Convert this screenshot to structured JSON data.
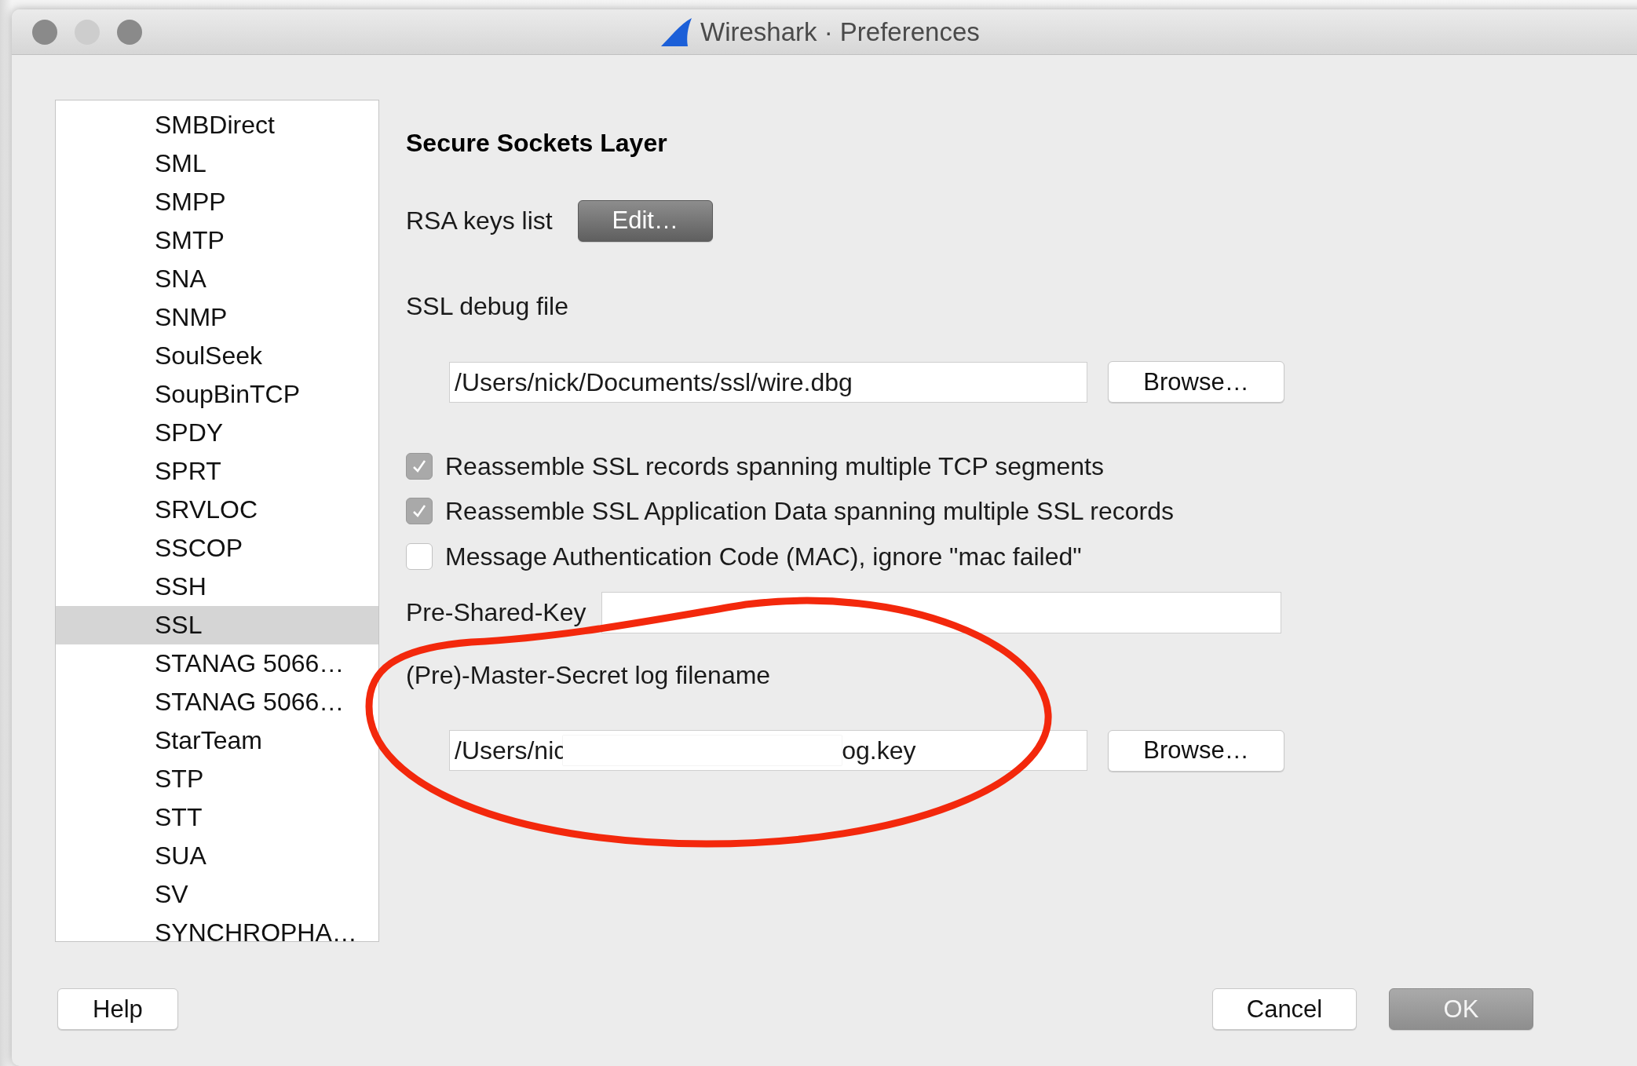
{
  "window": {
    "title": "Wireshark · Preferences"
  },
  "sidebar": {
    "items": [
      {
        "label": "SMBDirect",
        "selected": false
      },
      {
        "label": "SML",
        "selected": false
      },
      {
        "label": "SMPP",
        "selected": false
      },
      {
        "label": "SMTP",
        "selected": false
      },
      {
        "label": "SNA",
        "selected": false
      },
      {
        "label": "SNMP",
        "selected": false
      },
      {
        "label": "SoulSeek",
        "selected": false
      },
      {
        "label": "SoupBinTCP",
        "selected": false
      },
      {
        "label": "SPDY",
        "selected": false
      },
      {
        "label": "SPRT",
        "selected": false
      },
      {
        "label": "SRVLOC",
        "selected": false
      },
      {
        "label": "SSCOP",
        "selected": false
      },
      {
        "label": "SSH",
        "selected": false
      },
      {
        "label": "SSL",
        "selected": true
      },
      {
        "label": "STANAG 5066…",
        "selected": false
      },
      {
        "label": "STANAG 5066…",
        "selected": false
      },
      {
        "label": "StarTeam",
        "selected": false
      },
      {
        "label": "STP",
        "selected": false
      },
      {
        "label": "STT",
        "selected": false
      },
      {
        "label": "SUA",
        "selected": false
      },
      {
        "label": "SV",
        "selected": false
      },
      {
        "label": "SYNCHROPHA…",
        "selected": false
      }
    ]
  },
  "panel": {
    "heading": "Secure Sockets Layer",
    "rsa_keys": {
      "label": "RSA keys list",
      "button": "Edit…"
    },
    "debug_file": {
      "label": "SSL debug file",
      "value": "/Users/nick/Documents/ssl/wire.dbg",
      "button": "Browse…"
    },
    "checkboxes": [
      {
        "label": "Reassemble SSL records spanning multiple TCP segments",
        "checked": true
      },
      {
        "label": "Reassemble SSL Application Data spanning multiple SSL records",
        "checked": true
      },
      {
        "label": "Message Authentication Code (MAC), ignore \"mac failed\"",
        "checked": false
      }
    ],
    "pre_shared_key": {
      "label": "Pre-Shared-Key"
    },
    "master_secret": {
      "label": "(Pre)-Master-Secret log filename",
      "value_start": "/Users/nic",
      "value_end": "og.key",
      "redacted": true,
      "button": "Browse…"
    }
  },
  "annotation": {
    "kind": "ellipse"
  },
  "buttons": [
    {
      "label": "Help",
      "kind": "normal"
    },
    {
      "label": "Cancel",
      "kind": "normal"
    },
    {
      "label": "OK",
      "kind": "default"
    }
  ]
}
